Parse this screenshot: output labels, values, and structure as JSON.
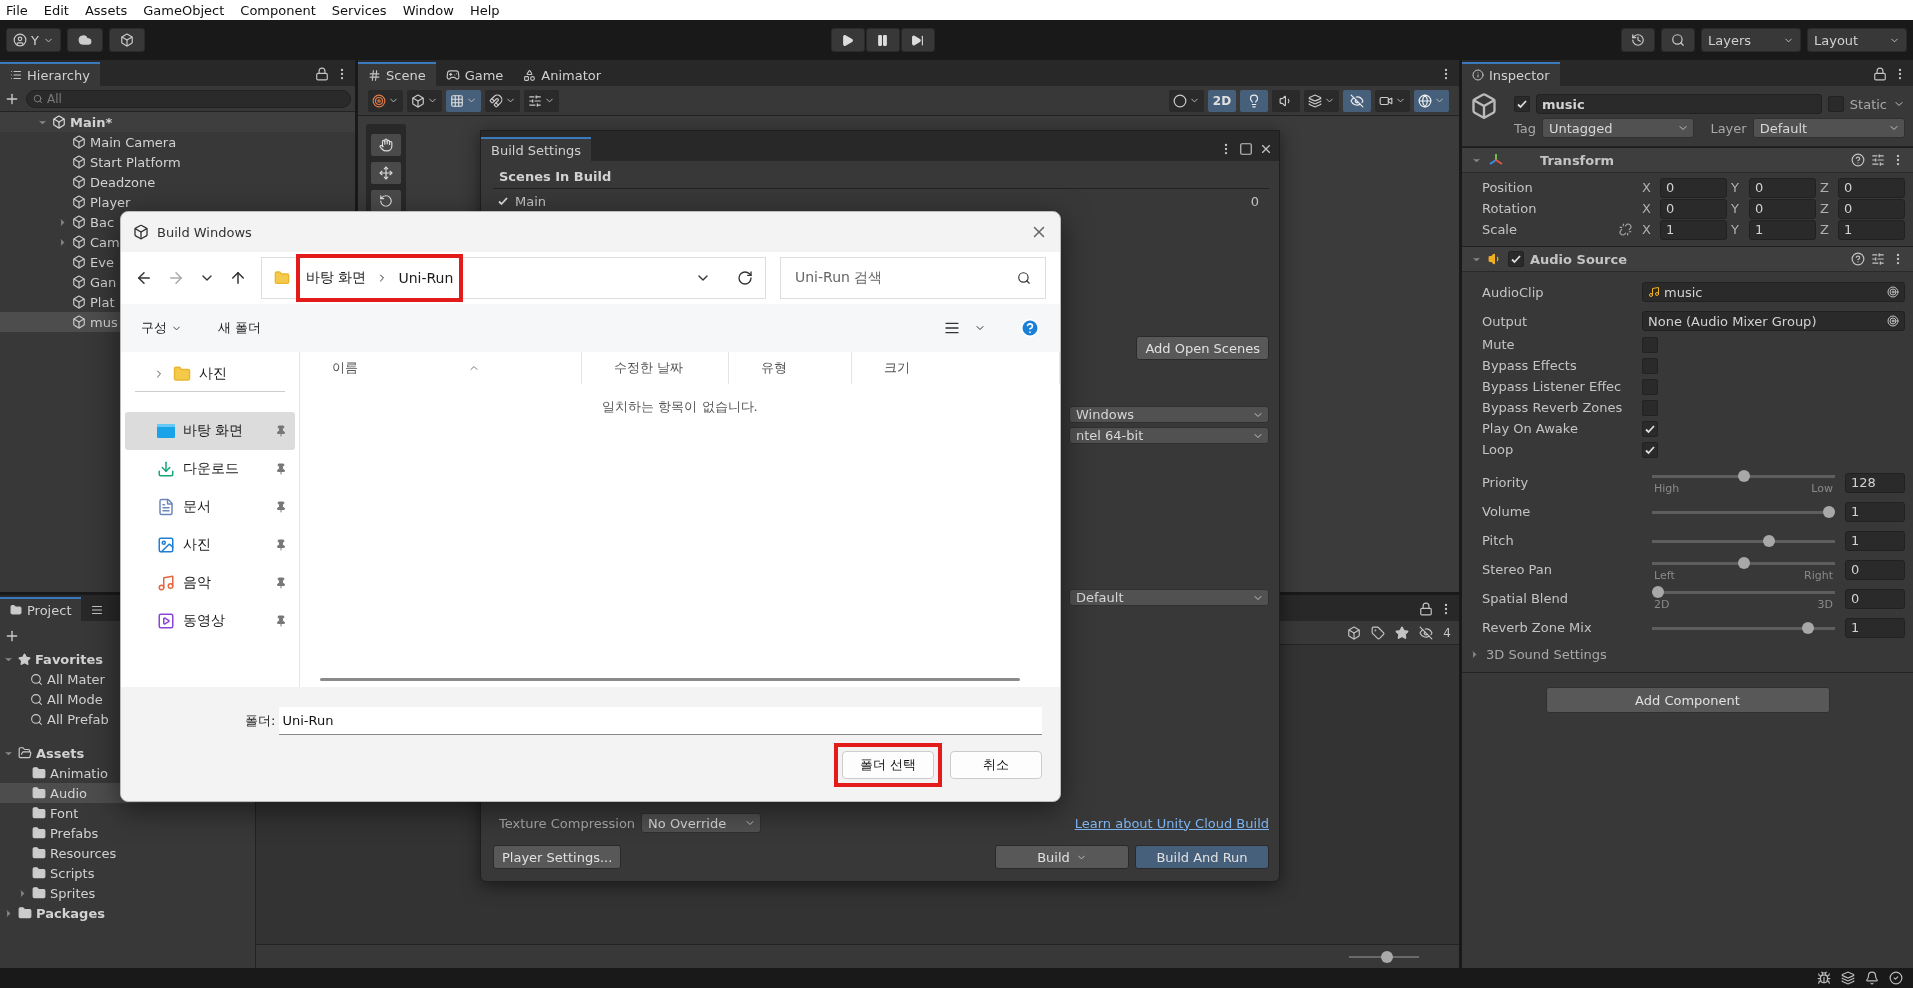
{
  "menu_bar": {
    "items": [
      "File",
      "Edit",
      "Assets",
      "GameObject",
      "Component",
      "Services",
      "Window",
      "Help"
    ]
  },
  "toolbar": {
    "account": "Y",
    "layers": "Layers",
    "layout": "Layout"
  },
  "hierarchy": {
    "tab": "Hierarchy",
    "search_placeholder": "All",
    "scene": {
      "label": "Main*",
      "expanded": true,
      "children": [
        {
          "label": "Main Camera",
          "kind": "object",
          "selected": false
        },
        {
          "label": "Start Platform",
          "kind": "object",
          "selected": false
        },
        {
          "label": "Deadzone",
          "kind": "object",
          "selected": false
        },
        {
          "label": "Player",
          "kind": "object",
          "selected": false
        },
        {
          "label": "Bac",
          "kind": "group",
          "selected": false
        },
        {
          "label": "Cam",
          "kind": "group",
          "selected": false
        },
        {
          "label": "Eve",
          "kind": "object",
          "selected": false
        },
        {
          "label": "Gan",
          "kind": "object",
          "selected": false
        },
        {
          "label": "Plat",
          "kind": "object",
          "selected": false
        },
        {
          "label": "mus",
          "kind": "object",
          "selected": true
        }
      ]
    }
  },
  "scene_view": {
    "tabs": [
      {
        "label": "Scene",
        "kind": "scene",
        "selected": true
      },
      {
        "label": "Game",
        "kind": "game",
        "selected": false
      },
      {
        "label": "Animator",
        "kind": "animator",
        "selected": false
      }
    ],
    "mode_2d": {
      "label": "2D",
      "on": true
    }
  },
  "project": {
    "tab": "Project",
    "hidden_count": "4",
    "zoom": {
      "level": 0.55
    },
    "favorites": {
      "label": "Favorites",
      "expanded": true,
      "children": [
        "All Mater",
        "All Mode",
        "All Prefab"
      ]
    },
    "assets": {
      "label": "Assets",
      "expanded": true,
      "children": [
        {
          "label": "Animatio",
          "kind": "folder",
          "selected": false
        },
        {
          "label": "Audio",
          "kind": "folder",
          "selected": true
        },
        {
          "label": "Font",
          "kind": "folder",
          "selected": false
        },
        {
          "label": "Prefabs",
          "kind": "folder",
          "selected": false
        },
        {
          "label": "Resources",
          "kind": "folder",
          "selected": false
        },
        {
          "label": "Scripts",
          "kind": "folder",
          "selected": false
        },
        {
          "label": "Sprites",
          "kind": "group",
          "selected": false
        }
      ]
    },
    "packages": {
      "label": "Packages",
      "expanded": false
    }
  },
  "inspector": {
    "tab": "Inspector",
    "object": {
      "name": "music",
      "active": true,
      "static_label": "Static",
      "static": false,
      "tag_label": "Tag",
      "tag": "Untagged",
      "layer_label": "Layer",
      "layer": "Default"
    },
    "transform": {
      "title": "Transform",
      "expanded": true,
      "rows": [
        {
          "label": "Position",
          "kind": "plain",
          "values": [
            {
              "axis": "X",
              "value": "0"
            },
            {
              "axis": "Y",
              "value": "0"
            },
            {
              "axis": "Z",
              "value": "0"
            }
          ]
        },
        {
          "label": "Rotation",
          "kind": "plain",
          "values": [
            {
              "axis": "X",
              "value": "0"
            },
            {
              "axis": "Y",
              "value": "0"
            },
            {
              "axis": "Z",
              "value": "0"
            }
          ]
        },
        {
          "label": "Scale",
          "kind": "scale",
          "values": [
            {
              "axis": "X",
              "value": "1"
            },
            {
              "axis": "Y",
              "value": "1"
            },
            {
              "axis": "Z",
              "value": "1"
            }
          ]
        }
      ]
    },
    "audio_source": {
      "title": "Audio Source",
      "expanded": true,
      "enabled": true,
      "clip_label": "AudioClip",
      "clip": "music",
      "output_label": "Output",
      "output": "None (Audio Mixer Group)",
      "toggles": [
        {
          "label": "Mute",
          "checked": false
        },
        {
          "label": "Bypass Effects",
          "checked": false
        },
        {
          "label": "Bypass Listener Effec",
          "checked": false
        },
        {
          "label": "Bypass Reverb Zones",
          "checked": false
        },
        {
          "label": "Play On Awake",
          "checked": true
        },
        {
          "label": "Loop",
          "checked": true
        }
      ],
      "sliders": [
        {
          "label": "Priority",
          "value": "128",
          "level": 0.5,
          "min_label": "High",
          "max_label": "Low"
        },
        {
          "label": "Volume",
          "value": "1",
          "level": 1
        },
        {
          "label": "Pitch",
          "value": "1",
          "level": 0.65
        },
        {
          "label": "Stereo Pan",
          "value": "0",
          "level": 0.5,
          "min_label": "Left",
          "max_label": "Right"
        },
        {
          "label": "Spatial Blend",
          "value": "0",
          "level": 0,
          "min_label": "2D",
          "max_label": "3D"
        },
        {
          "label": "Reverb Zone Mix",
          "value": "1",
          "level": 0.88
        }
      ],
      "sound_settings": {
        "label": "3D Sound Settings",
        "expanded": false
      }
    },
    "add_component": "Add Component"
  },
  "build_settings": {
    "title": "Build Settings",
    "scenes_heading": "Scenes In Build",
    "scenes": [
      {
        "name": "Main",
        "checked": true,
        "index": "0"
      }
    ],
    "add_open_scenes": "Add Open Scenes",
    "platform_dropdowns": [
      "Windows",
      "ntel 64-bit"
    ],
    "compression_dropdown": "Default",
    "texture_compression": {
      "label": "Texture Compression",
      "value": "No Override"
    },
    "cloud_link": "Learn about Unity Cloud Build",
    "player_settings": "Player Settings...",
    "build": "Build",
    "build_and_run": "Build And Run"
  },
  "file_dialog": {
    "title": "Build Windows",
    "breadcrumb": {
      "items": [
        "바탕 화면",
        "Uni-Run"
      ],
      "highlighted": true
    },
    "search_placeholder": "Uni-Run 검색",
    "commands": [
      {
        "label": "구성",
        "kind": "menu"
      },
      {
        "label": "새 폴더",
        "kind": "plain"
      }
    ],
    "nav_top": {
      "label": "사진",
      "expanded": false
    },
    "quick_access": [
      {
        "label": "바탕 화면",
        "kind": "desktop",
        "selected": true
      },
      {
        "label": "다운로드",
        "kind": "download",
        "selected": false
      },
      {
        "label": "문서",
        "kind": "document",
        "selected": false
      },
      {
        "label": "사진",
        "kind": "picture",
        "selected": false
      },
      {
        "label": "음악",
        "kind": "music",
        "selected": false
      },
      {
        "label": "동영상",
        "kind": "video",
        "selected": false
      }
    ],
    "columns": [
      "이름",
      "수정한 날짜",
      "유형",
      "크기"
    ],
    "empty_message": "일치하는 항목이 없습니다.",
    "folder_label": "폴더:",
    "folder_value": "Uni-Run",
    "select_button": {
      "label": "폴더 선택",
      "highlighted": true
    },
    "cancel_button": "취소"
  }
}
